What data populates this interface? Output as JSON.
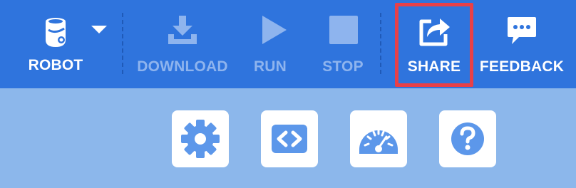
{
  "toolbar": {
    "robot": {
      "label": "ROBOT",
      "icon": "robot-icon",
      "dropdown_icon": "caret-down-icon"
    },
    "download": {
      "label": "DOWNLOAD",
      "icon": "download-icon",
      "enabled": false
    },
    "run": {
      "label": "RUN",
      "icon": "play-icon",
      "enabled": false
    },
    "stop": {
      "label": "STOP",
      "icon": "stop-icon",
      "enabled": false
    },
    "share": {
      "label": "SHARE",
      "icon": "share-icon",
      "highlighted": true
    },
    "feedback": {
      "label": "FEEDBACK",
      "icon": "chat-bubble-icon"
    }
  },
  "subtoolbar": {
    "buttons": [
      {
        "name": "settings",
        "icon": "gear-icon"
      },
      {
        "name": "code",
        "icon": "code-brackets-icon"
      },
      {
        "name": "dashboard",
        "icon": "speedometer-icon"
      },
      {
        "name": "help",
        "icon": "question-icon"
      }
    ]
  },
  "colors": {
    "toolbar_bg": "#2f74dd",
    "subtoolbar_bg": "#8cb7eb",
    "disabled_text": "#8eb4ee",
    "highlight": "#e84048",
    "icon_blue": "#5c97ea"
  }
}
